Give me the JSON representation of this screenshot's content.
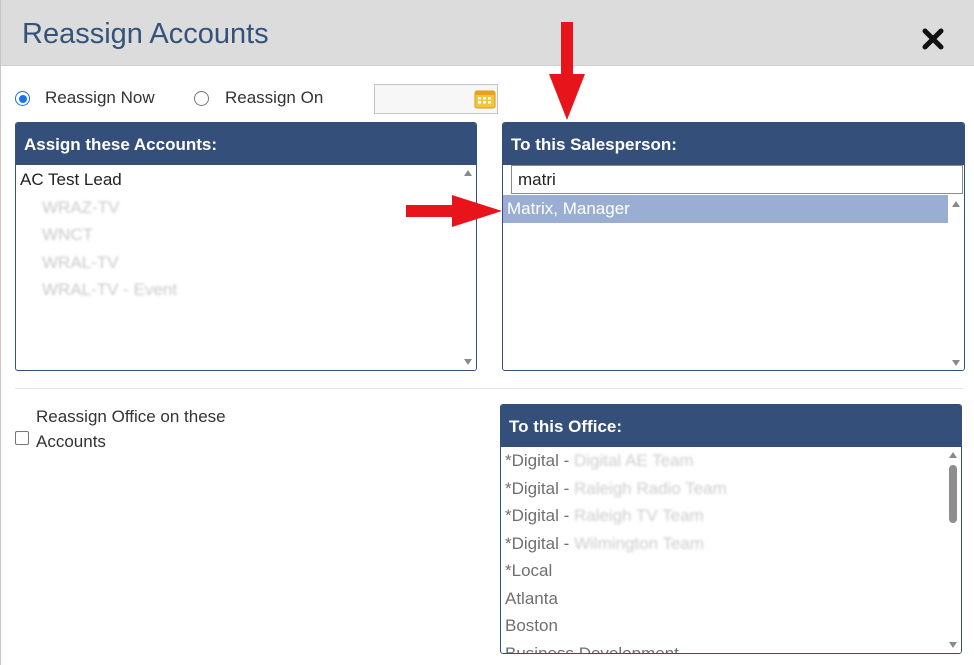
{
  "dialog": {
    "title": "Reassign Accounts",
    "close_icon": "close-icon"
  },
  "reassign": {
    "now_label": "Reassign Now",
    "on_label": "Reassign On",
    "selected": "Reassign Now",
    "date_value": ""
  },
  "accounts_panel": {
    "header": "Assign these Accounts:",
    "items": [
      "AC Test Lead",
      "WRAZ-TV",
      "WNCT",
      "WRAL-TV",
      "WRAL-TV - Event"
    ]
  },
  "salesperson_panel": {
    "header": "To this Salesperson:",
    "search_value": "matri",
    "items": [
      "Matrix, Manager"
    ]
  },
  "office_section": {
    "checkbox_label": "Reassign Office on these Accounts",
    "checked": false
  },
  "office_panel": {
    "header": "To this Office:",
    "items": [
      {
        "prefix": "*Digital - ",
        "rest": "Digital AE Team"
      },
      {
        "prefix": "*Digital - ",
        "rest": "Raleigh Radio Team"
      },
      {
        "prefix": "*Digital - ",
        "rest": "Raleigh TV Team"
      },
      {
        "prefix": "*Digital - ",
        "rest": "Wilmington Team"
      },
      {
        "prefix": "*Local",
        "rest": ""
      },
      {
        "prefix": "Atlanta",
        "rest": ""
      },
      {
        "prefix": "Boston",
        "rest": ""
      },
      {
        "prefix": "Business Development",
        "rest": ""
      }
    ]
  },
  "colors": {
    "header_blue": "#34507a",
    "title_blue": "#34537a",
    "selection": "#9aaed4",
    "annotation_red": "#e8141b"
  },
  "annotations": [
    "down-arrow-annotation-icon",
    "right-arrow-annotation-icon"
  ]
}
